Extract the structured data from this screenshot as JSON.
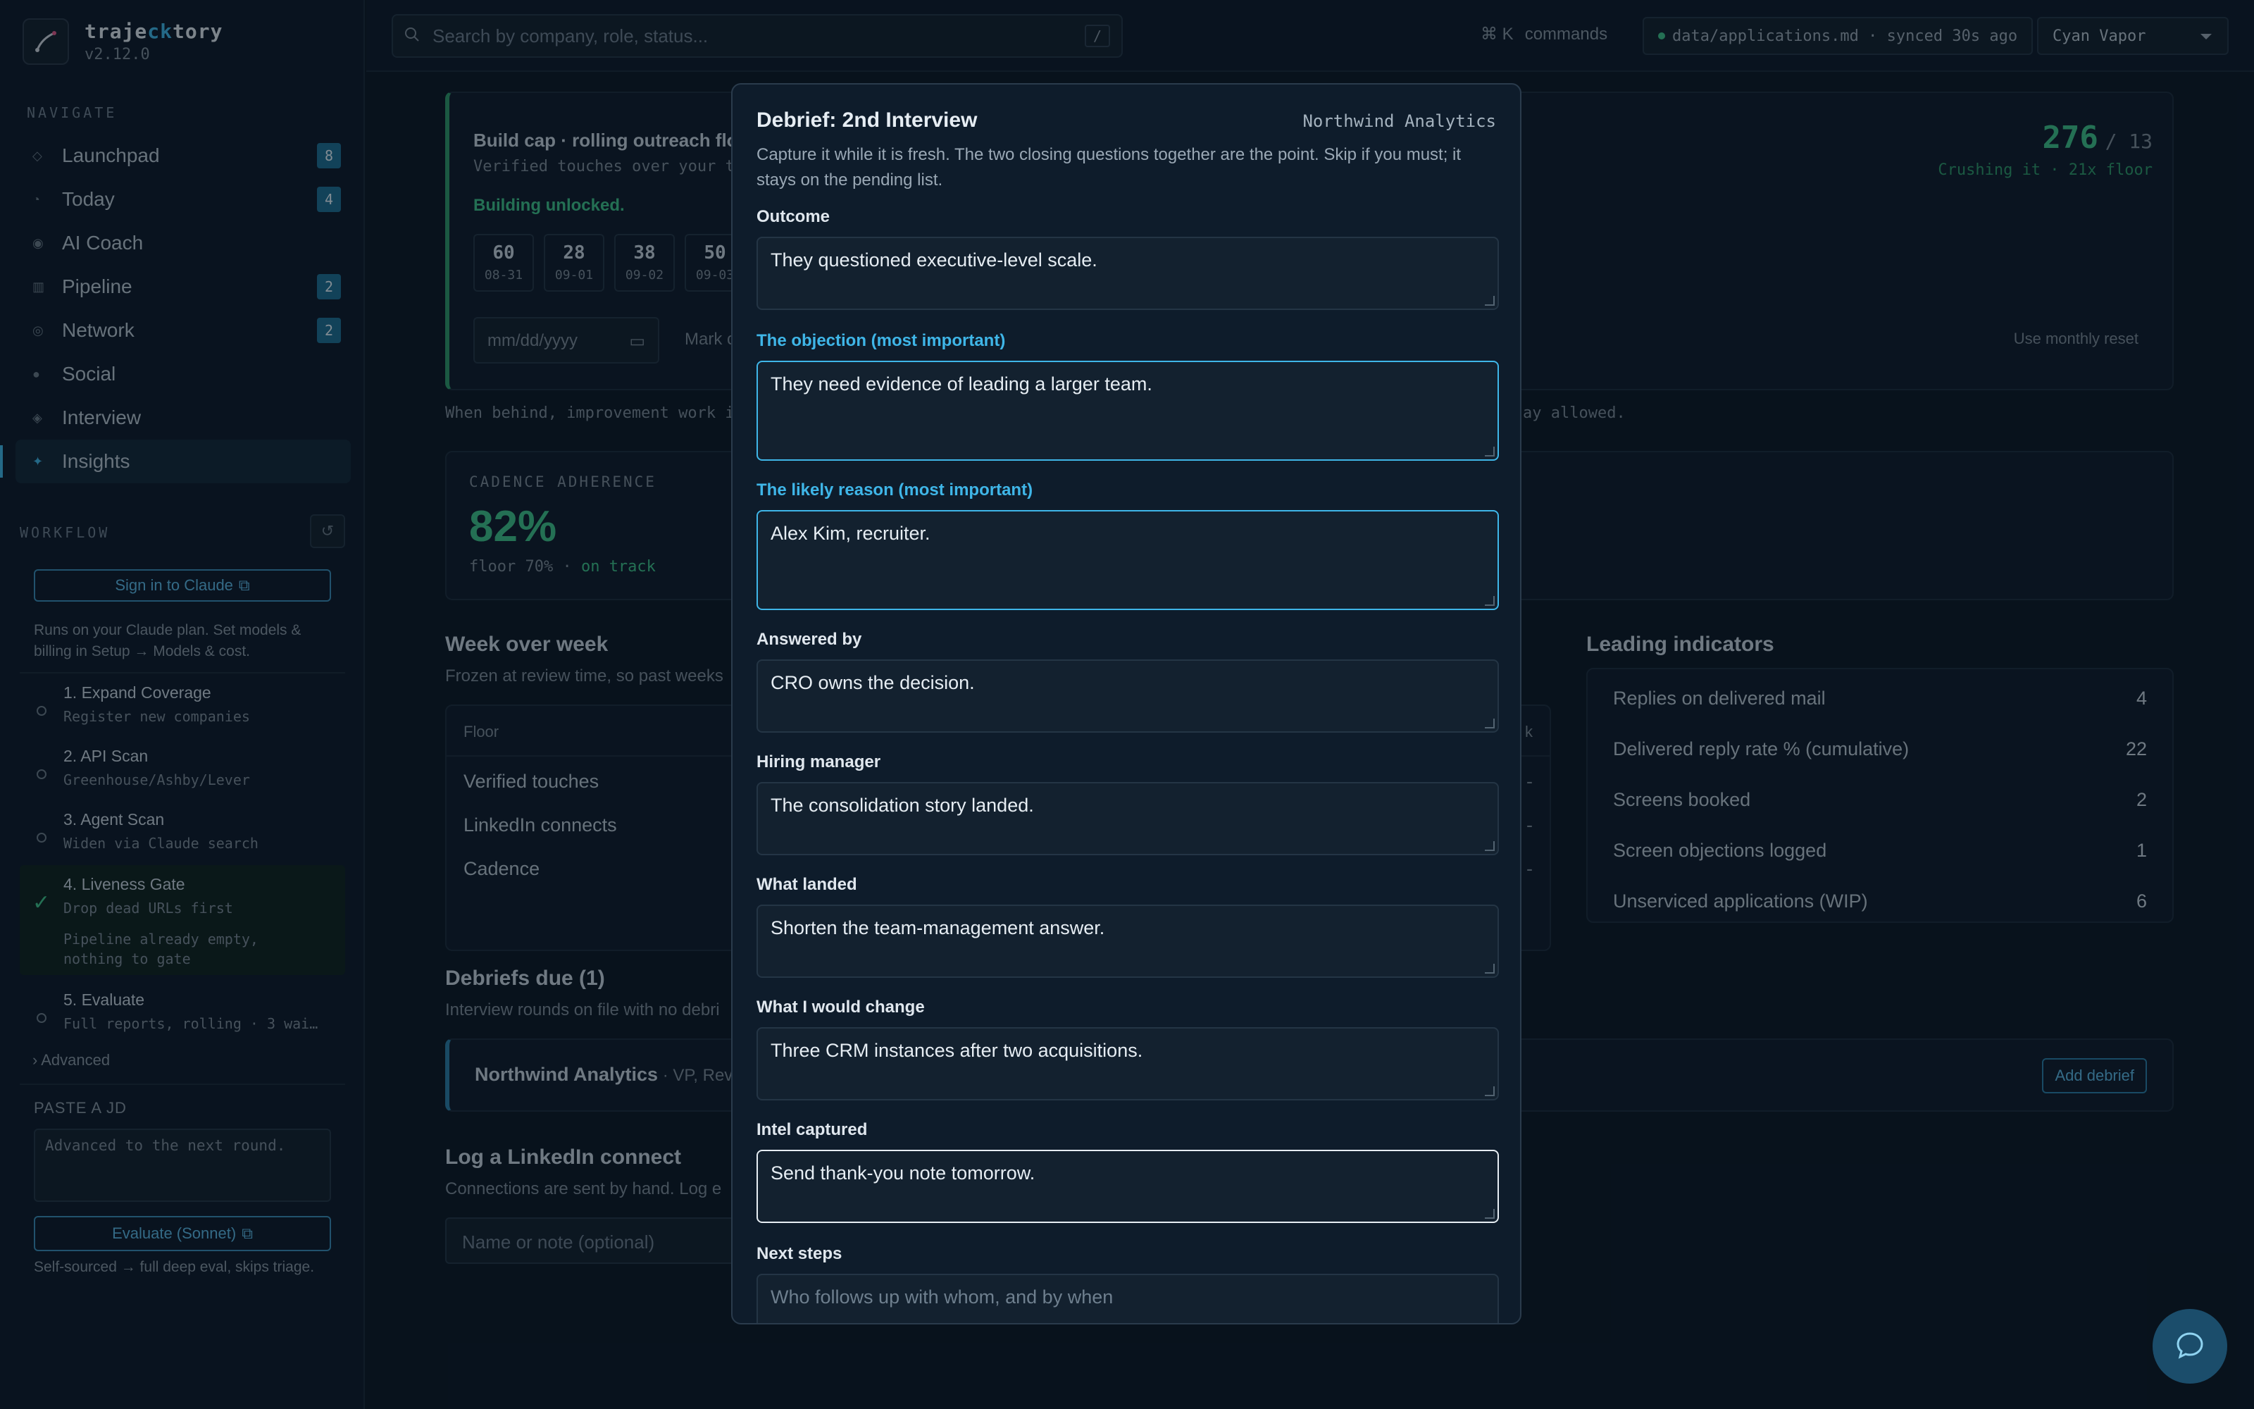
{
  "brand": {
    "name_pre": "traje",
    "name_hl": "ck",
    "name_post": "tory",
    "version": "v2.12.0"
  },
  "sidebar": {
    "nav_label": "NAVIGATE",
    "items": [
      {
        "label": "Launchpad",
        "badge": "8"
      },
      {
        "label": "Today",
        "badge": "4"
      },
      {
        "label": "AI Coach",
        "badge": ""
      },
      {
        "label": "Pipeline",
        "badge": "2"
      },
      {
        "label": "Network",
        "badge": "2"
      },
      {
        "label": "Social",
        "badge": ""
      },
      {
        "label": "Interview",
        "badge": ""
      },
      {
        "label": "Insights",
        "badge": ""
      }
    ],
    "workflow_label": "WORKFLOW",
    "signin_label": "Sign in to Claude",
    "signin_note": "Runs on your Claude plan. Set models & billing in Setup → Models & cost.",
    "steps": [
      {
        "title": "1. Expand Coverage",
        "sub": "Register new companies"
      },
      {
        "title": "2. API Scan",
        "sub": "Greenhouse/Ashby/Lever"
      },
      {
        "title": "3. Agent Scan",
        "sub": "Widen via Claude search"
      },
      {
        "title": "4. Liveness Gate",
        "sub": "Drop dead URLs first",
        "note": "Pipeline already empty, nothing to gate"
      },
      {
        "title": "5. Evaluate",
        "sub": "Full reports, rolling · 3 wai…"
      }
    ],
    "advanced_label": "Advanced",
    "paste_label": "PASTE A JD",
    "paste_value": "Advanced to the next round.",
    "evaluate_label": "Evaluate (Sonnet)",
    "evaluate_note": "Self-sourced → full deep eval, skips triage."
  },
  "topbar": {
    "search_placeholder": "Search by company, role, status...",
    "search_kbd": "/",
    "cmd_key": "⌘ K",
    "cmd_label": "commands",
    "sync_text": "data/applications.md · synced 30s ago",
    "theme": "Cyan Vapor"
  },
  "main": {
    "build_title": "Build cap · rolling outreach flo",
    "build_sub": "Verified touches over your t",
    "build_unlocked": "Building unlocked.",
    "days": [
      {
        "n": "60",
        "d": "08-31"
      },
      {
        "n": "28",
        "d": "09-01"
      },
      {
        "n": "38",
        "d": "09-02"
      },
      {
        "n": "50",
        "d": "09-03"
      }
    ],
    "date_placeholder": "mm/dd/yyyy",
    "mark_label": "Mark c",
    "score": "276",
    "score_of": "/ 13",
    "score_note": "Crushing it · 21x floor",
    "monthly_reset": "Use monthly reset",
    "behind_note_left": "When behind, improvement work i",
    "behind_note_right": "ay allowed.",
    "cadence_label": "CADENCE ADHERENCE",
    "cadence_value": "82%",
    "cadence_floor": "floor 70% · ",
    "cadence_status": "on track",
    "wow_title": "Week over week",
    "wow_sub": "Frozen at review time, so past weeks",
    "wow_header": "Floor",
    "wow_header_right": "k",
    "wow_rows": [
      {
        "label": "Verified touches",
        "val": "-"
      },
      {
        "label": "LinkedIn connects",
        "val": "-"
      },
      {
        "label": "Cadence",
        "val": "-"
      }
    ],
    "lead_title": "Leading indicators",
    "lead_rows": [
      {
        "label": "Replies on delivered mail",
        "val": "4"
      },
      {
        "label": "Delivered reply rate % (cumulative)",
        "val": "22"
      },
      {
        "label": "Screens booked",
        "val": "2"
      },
      {
        "label": "Screen objections logged",
        "val": "1"
      },
      {
        "label": "Unserviced applications (WIP)",
        "val": "6"
      }
    ],
    "debriefs_title": "Debriefs due (1)",
    "debriefs_sub": "Interview rounds on file with no debri",
    "debrief_company": "Northwind Analytics",
    "debrief_role": " · VP, Reve",
    "add_debrief": "Add debrief",
    "li_title": "Log a LinkedIn connect",
    "li_sub": "Connections are sent by hand. Log e",
    "li_placeholder": "Name or note (optional)"
  },
  "modal": {
    "title": "Debrief: 2nd Interview",
    "company": "Northwind Analytics",
    "description": "Capture it while it is fresh. The two closing questions together are the point. Skip if you must; it stays on the pending list.",
    "fields": [
      {
        "label": "Outcome",
        "value": "They questioned executive-level scale."
      },
      {
        "label": "The objection (most important)",
        "value": "They need evidence of leading a larger team."
      },
      {
        "label": "The likely reason (most important)",
        "value": "Alex Kim, recruiter."
      },
      {
        "label": "Answered by",
        "value": "CRO owns the decision."
      },
      {
        "label": "Hiring manager",
        "value": "The consolidation story landed."
      },
      {
        "label": "What landed",
        "value": "Shorten the team-management answer."
      },
      {
        "label": "What I would change",
        "value": "Three CRM instances after two acquisitions."
      },
      {
        "label": "Intel captured",
        "value": "Send thank-you note tomorrow."
      },
      {
        "label": "Next steps",
        "placeholder": "Who follows up with whom, and by when"
      }
    ]
  },
  "colors": {
    "accent": "#3fb6e8",
    "success": "#3fc48a",
    "bg": "#0b1826"
  },
  "icons": [
    "search-icon",
    "chat-icon",
    "chevron-down-icon",
    "refresh-icon",
    "external-link-icon",
    "check-icon",
    "calendar-icon"
  ]
}
